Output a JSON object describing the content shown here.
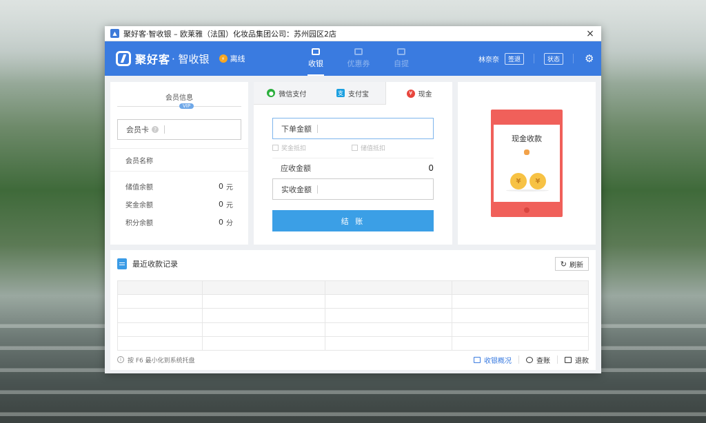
{
  "window": {
    "title": "聚好客·智收银 – 欧莱雅（法国）化妆品集团公司：苏州园区2店"
  },
  "header": {
    "brand_name": "聚好客",
    "brand_sub": "· 智收银",
    "status": "离线",
    "nav": [
      {
        "label": "收银",
        "icon": "cashier-icon",
        "active": true
      },
      {
        "label": "优惠券",
        "icon": "coupon-icon",
        "active": false
      },
      {
        "label": "自提",
        "icon": "pickup-icon",
        "active": false
      }
    ],
    "user_name": "林奈奈",
    "sign_in_label": "签退",
    "status_label": "状态"
  },
  "member": {
    "heading": "会员信息",
    "vip_badge": "VIP",
    "card_placeholder": "会员卡",
    "name_label": "会员名称",
    "balances": [
      {
        "label": "储值余额",
        "value": "0",
        "unit": "元"
      },
      {
        "label": "奖金余额",
        "value": "0",
        "unit": "元"
      },
      {
        "label": "积分余额",
        "value": "0",
        "unit": "分"
      }
    ]
  },
  "payment": {
    "tabs": [
      {
        "label": "微信支付",
        "icon": "wechat-icon"
      },
      {
        "label": "支付宝",
        "icon": "alipay-icon"
      },
      {
        "label": "现金",
        "icon": "yuan-icon"
      }
    ],
    "order_amount_placeholder": "下单金额",
    "checkbox_bonus": "奖金抵扣",
    "checkbox_stored": "储值抵扣",
    "due_label": "应收金额",
    "due_value": "0",
    "received_placeholder": "实收金额",
    "checkout_label": "结 账"
  },
  "cash": {
    "title": "现金收款",
    "coin_symbol": "¥"
  },
  "records": {
    "title": "最近收款记录",
    "refresh_label": "刷新",
    "rows": 5,
    "columns": 4
  },
  "footer": {
    "hint": "按 F6 最小化到系统托盘",
    "links": [
      {
        "label": "收银概况",
        "icon": "overview-icon"
      },
      {
        "label": "查账",
        "icon": "audit-icon"
      },
      {
        "label": "退款",
        "icon": "refund-icon"
      }
    ]
  },
  "colors": {
    "header_blue": "#3a7be0",
    "checkout_blue": "#3b9fe6",
    "cash_red": "#f0605a",
    "wechat_green": "#2aae3c"
  }
}
